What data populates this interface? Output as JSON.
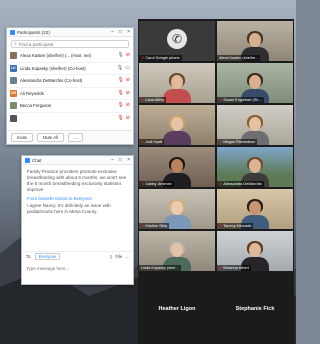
{
  "participants": {
    "title": "Participants (22)",
    "search_placeholder": "Find a participant",
    "rows": [
      {
        "initials": "",
        "name": "Alexa Kasten (she/her) (... (Host, me)",
        "color": "#8a6f5a",
        "mic": "on",
        "video": "off"
      },
      {
        "initials": "LK",
        "name": "Linda Kopasky (she/her) (Co-host)",
        "color": "#3d6fb8",
        "mic": "on",
        "video": "on"
      },
      {
        "initials": "",
        "name": "Alessandra DeMarchis (Co-host)",
        "color": "#6b7f8e",
        "mic": "muted",
        "video": "off"
      },
      {
        "initials": "AR",
        "name": "Ali Reynolds",
        "color": "#e07a2b",
        "mic": "muted",
        "video": "off"
      },
      {
        "initials": "",
        "name": "Becca Ferguson",
        "color": "#7a8c6a",
        "mic": "muted",
        "video": "off"
      },
      {
        "initials": "",
        "name": "",
        "color": "#555555",
        "mic": "muted",
        "video": "off"
      }
    ],
    "invite_label": "Invite",
    "mute_all_label": "Mute All",
    "more_label": "..."
  },
  "chat": {
    "title": "Chat",
    "message1": "Family Practice providers promote exclusive breastfeeding with about 6 months. we won't see the 6 month breastfeeding exclusivity statistics improve",
    "from_label": "From Danielle Garcia to Everyone:",
    "message2": "I agree Nancy. It's definitely an issue with pediatricians here in Mesa County.",
    "to_label": "To:",
    "to_value": "Everyone",
    "file_label": "File",
    "more_label": "...",
    "input_placeholder": "Type message here..."
  },
  "gallery": {
    "tiles": [
      {
        "name": "Carol Svingle phone",
        "type": "phone"
      },
      {
        "name": "Alexa Kasten (she/he...",
        "type": "video"
      },
      {
        "name": "Lana Alfrey",
        "type": "video"
      },
      {
        "name": "Susan Englehart (Sh...",
        "type": "video"
      },
      {
        "name": "Jodi Hyatt",
        "type": "video"
      },
      {
        "name": "Megan Richardson",
        "type": "video"
      },
      {
        "name": "Gabby Jimenez",
        "type": "video"
      },
      {
        "name": "Alessandra DeMarchis",
        "type": "video"
      },
      {
        "name": "Kristine Sibly",
        "type": "video"
      },
      {
        "name": "Tammy Mercado",
        "type": "video"
      },
      {
        "name": "Linda Kopasky (she/...",
        "type": "video"
      },
      {
        "name": "Breanna Hibert",
        "type": "video"
      }
    ],
    "bottom_left_name": "Heather Ligon",
    "bottom_right_name": "Stephanie Fick"
  }
}
